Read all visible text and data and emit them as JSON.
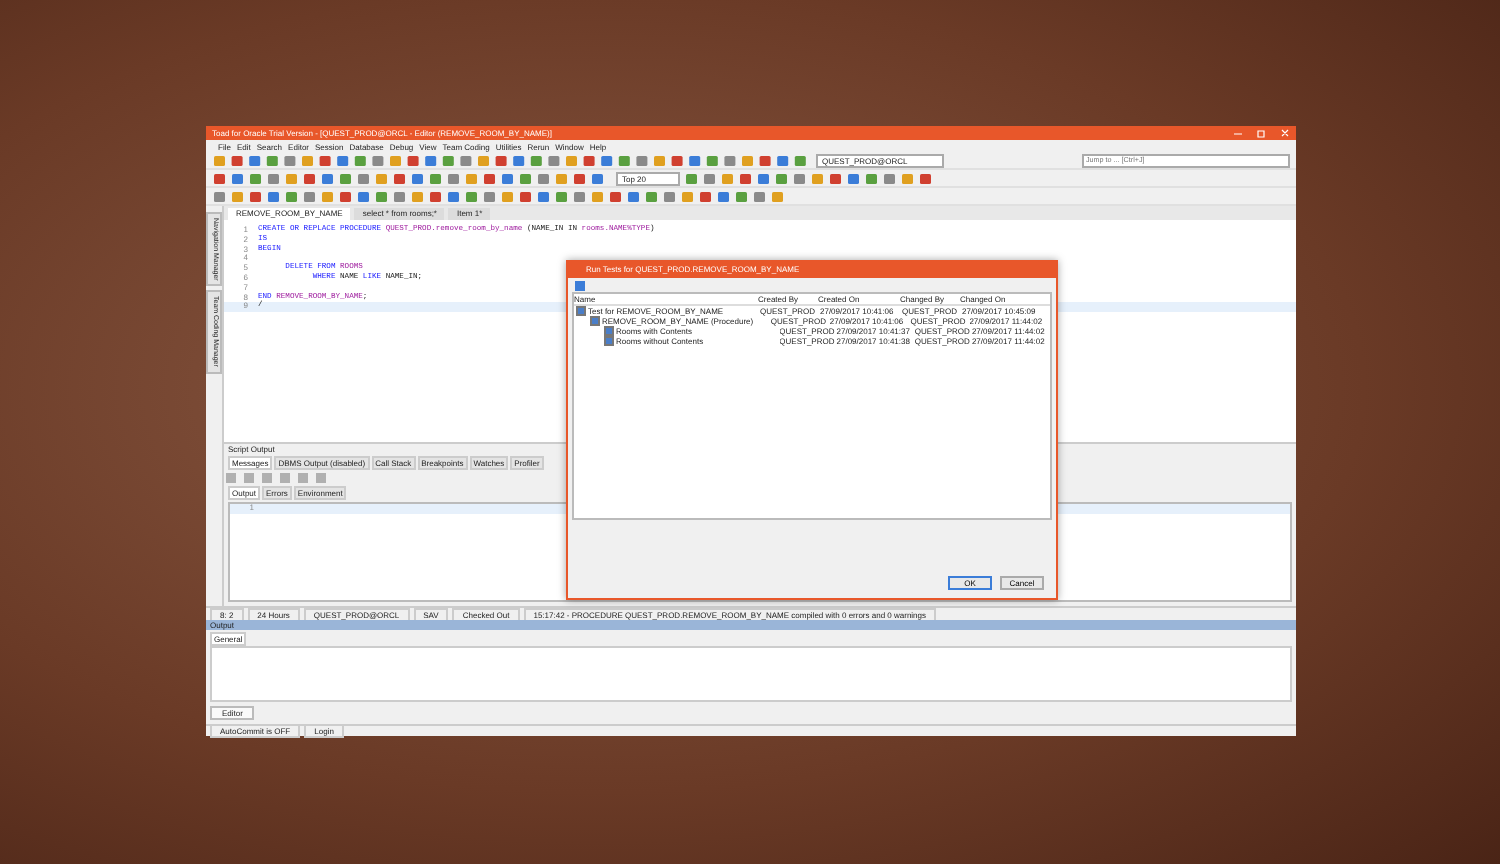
{
  "window": {
    "title": "Toad for Oracle Trial Version - [QUEST_PROD@ORCL - Editor (REMOVE_ROOM_BY_NAME)]"
  },
  "menu": [
    "File",
    "Edit",
    "Search",
    "Editor",
    "Session",
    "Database",
    "Debug",
    "View",
    "Team Coding",
    "Utilities",
    "Rerun",
    "Window",
    "Help"
  ],
  "jump_field": {
    "placeholder": "Jump to ... [Ctrl+J]"
  },
  "connection_combo": {
    "value": "QUEST_PROD@ORCL"
  },
  "rows_combo": {
    "value": "Top 20"
  },
  "side_tabs": [
    "Navigation Manager",
    "Team Coding Manager"
  ],
  "editor_tabs": [
    {
      "label": "REMOVE_ROOM_BY_NAME",
      "selected": true
    },
    {
      "label": "select * from rooms;*",
      "selected": false
    },
    {
      "label": "Item 1*",
      "selected": false
    }
  ],
  "code_lines": [
    {
      "number": "1",
      "current": false,
      "segments": [
        {
          "kind": "keyword",
          "text": "CREATE OR REPLACE PROCEDURE "
        },
        {
          "kind": "ident",
          "text": "QUEST_PROD.remove_room_by_name"
        },
        {
          "kind": "plain",
          "text": " (NAME_IN IN "
        },
        {
          "kind": "ident",
          "text": "rooms.NAME%TYPE"
        },
        {
          "kind": "plain",
          "text": ")"
        }
      ]
    },
    {
      "number": "2",
      "current": false,
      "segments": [
        {
          "kind": "keyword",
          "text": "IS"
        }
      ]
    },
    {
      "number": "3",
      "current": false,
      "segments": [
        {
          "kind": "keyword",
          "text": "BEGIN"
        }
      ]
    },
    {
      "number": "4",
      "current": false
    },
    {
      "number": "5",
      "current": false,
      "segments": [
        {
          "kind": "keyword",
          "text": "      DELETE FROM "
        },
        {
          "kind": "ident",
          "text": "ROOMS"
        }
      ]
    },
    {
      "number": "6",
      "current": false,
      "segments": [
        {
          "kind": "keyword",
          "text": "            WHERE "
        },
        {
          "kind": "plain",
          "text": "NAME "
        },
        {
          "kind": "keyword",
          "text": "LIKE "
        },
        {
          "kind": "plain",
          "text": "NAME_IN;"
        }
      ]
    },
    {
      "number": "7",
      "current": false
    },
    {
      "number": "8",
      "current": false,
      "segments": [
        {
          "kind": "keyword",
          "text": "END "
        },
        {
          "kind": "ident",
          "text": "REMOVE_ROOM_BY_NAME"
        },
        {
          "kind": "plain",
          "text": ";"
        }
      ]
    },
    {
      "number": "9",
      "current": true,
      "segments": [
        {
          "kind": "plain",
          "text": "/"
        }
      ]
    }
  ],
  "script_output": {
    "title": "Script Output",
    "tabs": [
      {
        "label": "Messages",
        "selected": true
      },
      {
        "label": "DBMS Output (disabled)",
        "selected": false
      },
      {
        "label": "Call Stack",
        "selected": false
      },
      {
        "label": "Breakpoints",
        "selected": false
      },
      {
        "label": "Watches",
        "selected": false
      },
      {
        "label": "Profiler",
        "selected": false
      }
    ],
    "subtabs": [
      {
        "label": "Output",
        "selected": true
      },
      {
        "label": "Errors",
        "selected": false
      },
      {
        "label": "Environment",
        "selected": false
      }
    ],
    "line_number": "1"
  },
  "status_bar": [
    "8: 2",
    "24 Hours",
    "QUEST_PROD@ORCL",
    "SAV",
    "Checked Out",
    "15:17:42 - PROCEDURE QUEST_PROD.REMOVE_ROOM_BY_NAME compiled with 0 errors and 0 warnings"
  ],
  "output_panel": {
    "title": "Output",
    "tab": "General"
  },
  "bottom_tab": "Editor",
  "bottom_status": [
    "AutoCommit is OFF",
    "Login"
  ],
  "dialog": {
    "title": "Run Tests for QUEST_PROD.REMOVE_ROOM_BY_NAME",
    "columns": [
      "Name",
      "Created By",
      "Created On",
      "Changed By",
      "Changed On"
    ],
    "tree": [
      {
        "name": "Test for REMOVE_ROOM_BY_NAME",
        "checked": true,
        "cells": [
          "QUEST_PROD",
          "27/09/2017 10:41:06",
          "QUEST_PROD",
          "27/09/2017 10:45:09"
        ],
        "children": [
          {
            "name": "REMOVE_ROOM_BY_NAME (Procedure)",
            "checked": true,
            "cells": [
              "QUEST_PROD",
              "27/09/2017 10:41:06",
              "QUEST_PROD",
              "27/09/2017 11:44:02"
            ],
            "children": [
              {
                "name": "Rooms with Contents",
                "checked": true,
                "cells": [
                  "QUEST_PROD",
                  "27/09/2017 10:41:37",
                  "QUEST_PROD",
                  "27/09/2017 11:44:02"
                ]
              },
              {
                "name": "Rooms without Contents",
                "checked": true,
                "cells": [
                  "QUEST_PROD",
                  "27/09/2017 10:41:38",
                  "QUEST_PROD",
                  "27/09/2017 11:44:02"
                ]
              }
            ]
          }
        ]
      }
    ],
    "buttons": [
      "OK",
      "Cancel"
    ]
  }
}
